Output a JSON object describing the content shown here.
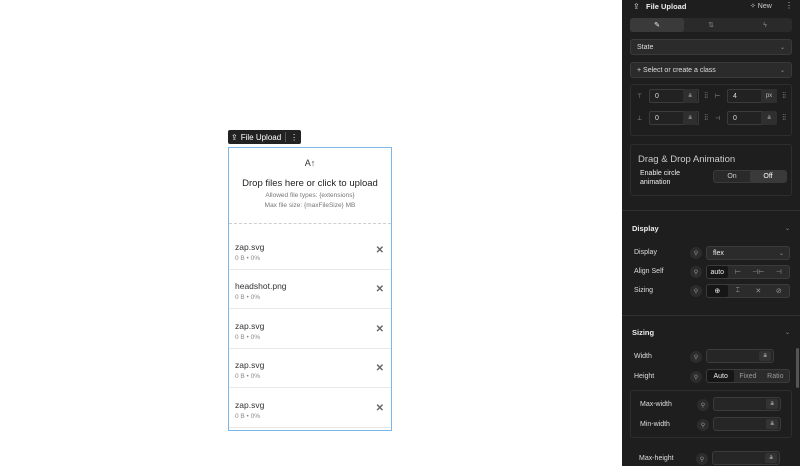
{
  "canvas": {
    "chip": {
      "icon": "upload-icon",
      "label": "File Upload",
      "more": "⋮"
    },
    "drop": {
      "icon": "upload-arrow-icon",
      "title": "Drop files here or click to upload",
      "allowed": "Allowed file types: {extensions}",
      "maxsize": "Max file size: {maxFileSize} MB"
    },
    "files": [
      {
        "name": "zap.svg",
        "meta": "0 B • 0%"
      },
      {
        "name": "headshot.png",
        "meta": "0 B • 0%"
      },
      {
        "name": "zap.svg",
        "meta": "0 B • 0%"
      },
      {
        "name": "zap.svg",
        "meta": "0 B • 0%"
      },
      {
        "name": "zap.svg",
        "meta": "0 B • 0%"
      }
    ]
  },
  "panel": {
    "header": {
      "title": "File Upload",
      "new": "✧ New",
      "more": "⋮"
    },
    "tabs": [
      "✎",
      "⇅",
      "ϟ"
    ],
    "state": "State",
    "class_select": "+ Select or create a class",
    "spacing": {
      "row1": {
        "left_val": "0",
        "left_unit": "a",
        "right_val": "4",
        "right_unit": "px"
      },
      "row2": {
        "left_val": "0",
        "left_unit": "a",
        "right_val": "0",
        "right_unit": "a"
      }
    },
    "dragdrop": {
      "title": "Drag & Drop Animation",
      "label": "Enable circle animation",
      "on": "On",
      "off": "Off"
    },
    "display_section": {
      "title": "Display",
      "display_label": "Display",
      "display_value": "flex",
      "align_self_label": "Align Self",
      "align_self_options": [
        "auto",
        "⊢",
        "⊣⊢",
        "⊣"
      ],
      "sizing_label": "Sizing",
      "sizing_options": [
        "⊕",
        "⌶",
        "✕",
        "⊘"
      ]
    },
    "sizing_section": {
      "title": "Sizing",
      "width_label": "Width",
      "width_unit": "a",
      "height_label": "Height",
      "height_options": [
        "Auto",
        "Fixed",
        "Ratio"
      ],
      "max_width_label": "Max-width",
      "max_width_unit": "a",
      "min_width_label": "Min-width",
      "min_width_unit": "a",
      "max_height_label": "Max-height",
      "max_height_unit": "a"
    }
  }
}
